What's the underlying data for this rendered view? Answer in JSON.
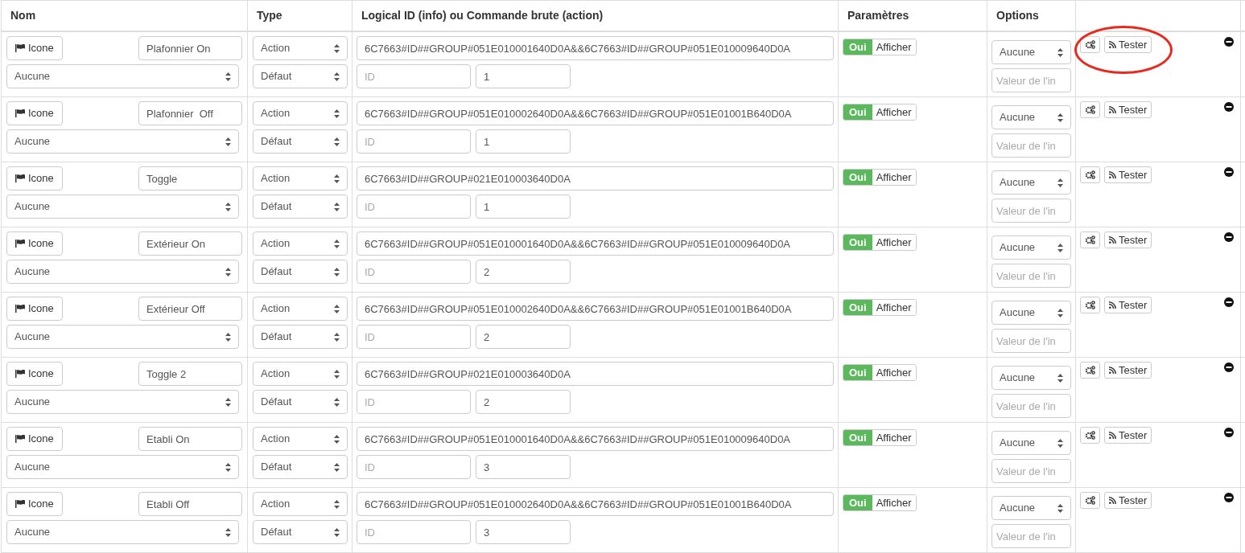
{
  "columns": [
    "Nom",
    "Type",
    "Logical ID (info) ou Commande brute (action)",
    "Paramètres",
    "Options"
  ],
  "rows": [
    {
      "icon_button": "Icone",
      "name": "Plafonnier On",
      "generic_type": "Aucune",
      "type": "Action",
      "subtype": "Défaut",
      "logical_id": "6C7663#ID##GROUP#051E010001640D0A&&6C7663#ID##GROUP#051E010009640D0A",
      "id_placeholder": "ID",
      "value": "1",
      "toggle_on": "Oui",
      "toggle_label": "Afficher",
      "visible": true,
      "option": "Aucune",
      "option_placeholder": "Valeur de l'in",
      "test_button": "Tester",
      "circled": true
    },
    {
      "icon_button": "Icone",
      "name": "Plafonnier  Off",
      "generic_type": "Aucune",
      "type": "Action",
      "subtype": "Défaut",
      "logical_id": "6C7663#ID##GROUP#051E010002640D0A&&6C7663#ID##GROUP#051E01001B640D0A",
      "id_placeholder": "ID",
      "value": "1",
      "toggle_on": "Oui",
      "toggle_label": "Afficher",
      "visible": true,
      "option": "Aucune",
      "option_placeholder": "Valeur de l'in",
      "test_button": "Tester",
      "circled": false
    },
    {
      "icon_button": "Icone",
      "name": "Toggle",
      "generic_type": "Aucune",
      "type": "Action",
      "subtype": "Défaut",
      "logical_id": "6C7663#ID##GROUP#021E010003640D0A",
      "id_placeholder": "ID",
      "value": "1",
      "toggle_on": "Oui",
      "toggle_label": "Afficher",
      "visible": true,
      "option": "Aucune",
      "option_placeholder": "Valeur de l'in",
      "test_button": "Tester",
      "circled": false
    },
    {
      "icon_button": "Icone",
      "name": "Extérieur On",
      "generic_type": "Aucune",
      "type": "Action",
      "subtype": "Défaut",
      "logical_id": "6C7663#ID##GROUP#051E010001640D0A&&6C7663#ID##GROUP#051E010009640D0A",
      "id_placeholder": "ID",
      "value": "2",
      "toggle_on": "Oui",
      "toggle_label": "Afficher",
      "visible": true,
      "option": "Aucune",
      "option_placeholder": "Valeur de l'in",
      "test_button": "Tester",
      "circled": false
    },
    {
      "icon_button": "Icone",
      "name": "Extérieur Off",
      "generic_type": "Aucune",
      "type": "Action",
      "subtype": "Défaut",
      "logical_id": "6C7663#ID##GROUP#051E010002640D0A&&6C7663#ID##GROUP#051E01001B640D0A",
      "id_placeholder": "ID",
      "value": "2",
      "toggle_on": "Oui",
      "toggle_label": "Afficher",
      "visible": true,
      "option": "Aucune",
      "option_placeholder": "Valeur de l'in",
      "test_button": "Tester",
      "circled": false
    },
    {
      "icon_button": "Icone",
      "name": "Toggle 2",
      "generic_type": "Aucune",
      "type": "Action",
      "subtype": "Défaut",
      "logical_id": "6C7663#ID##GROUP#021E010003640D0A",
      "id_placeholder": "ID",
      "value": "2",
      "toggle_on": "Oui",
      "toggle_label": "Afficher",
      "visible": true,
      "option": "Aucune",
      "option_placeholder": "Valeur de l'in",
      "test_button": "Tester",
      "circled": false
    },
    {
      "icon_button": "Icone",
      "name": "Etabli On",
      "generic_type": "Aucune",
      "type": "Action",
      "subtype": "Défaut",
      "logical_id": "6C7663#ID##GROUP#051E010001640D0A&&6C7663#ID##GROUP#051E010009640D0A",
      "id_placeholder": "ID",
      "value": "3",
      "toggle_on": "Oui",
      "toggle_label": "Afficher",
      "visible": true,
      "option": "Aucune",
      "option_placeholder": "Valeur de l'in",
      "test_button": "Tester",
      "circled": false
    },
    {
      "icon_button": "Icone",
      "name": "Etabli Off",
      "generic_type": "Aucune",
      "type": "Action",
      "subtype": "Défaut",
      "logical_id": "6C7663#ID##GROUP#051E010002640D0A&&6C7663#ID##GROUP#051E01001B640D0A",
      "id_placeholder": "ID",
      "value": "3",
      "toggle_on": "Oui",
      "toggle_label": "Afficher",
      "visible": true,
      "option": "Aucune",
      "option_placeholder": "Valeur de l'in",
      "test_button": "Tester",
      "circled": false
    }
  ]
}
